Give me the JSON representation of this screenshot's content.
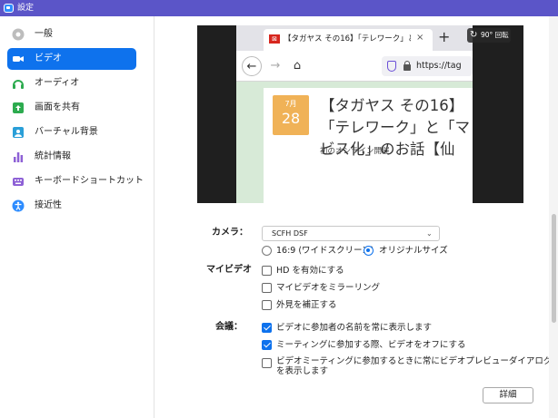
{
  "window": {
    "title": "設定"
  },
  "sidebar": {
    "items": [
      {
        "label": "一般",
        "icon": "gear-icon",
        "color": "#9e9e9e"
      },
      {
        "label": "ビデオ",
        "icon": "video-camera-icon",
        "color": "#ffffff",
        "active": true
      },
      {
        "label": "オーディオ",
        "icon": "headphones-icon",
        "color": "#2dab4f"
      },
      {
        "label": "画面を共有",
        "icon": "share-screen-icon",
        "color": "#2dab4f"
      },
      {
        "label": "バーチャル背景",
        "icon": "virtual-background-icon",
        "color": "#2a9fd8"
      },
      {
        "label": "統計情報",
        "icon": "statistics-icon",
        "color": "#8e61d6"
      },
      {
        "label": "キーボードショートカット",
        "icon": "keyboard-icon",
        "color": "#8e61d6"
      },
      {
        "label": "接近性",
        "icon": "accessibility-icon",
        "color": "#2d8cff"
      }
    ]
  },
  "preview": {
    "tab_title": "【タガヤス その16】「テレワーク」と「マ",
    "tab_close": "×",
    "new_tab": "+",
    "url": "https://tag",
    "date_month": "7月",
    "date_day": "28",
    "heading": "【タガヤス その16】「テレワーク」と「マ ビス化」のお話【仙",
    "subtitle": "初のオンライン開催",
    "rotate_label": "90° 回転"
  },
  "camera": {
    "label": "カメラ：",
    "selected": "SCFH DSF",
    "aspect_options": [
      {
        "label": "16:9 (ワイドスクリーン)",
        "selected": false
      },
      {
        "label": "オリジナルサイズ",
        "selected": true
      }
    ]
  },
  "my_video": {
    "label": "マイビデオ",
    "options": [
      {
        "label": "HD を有効にする",
        "checked": false
      },
      {
        "label": "マイビデオをミラーリング",
        "checked": false
      },
      {
        "label": "外見を補正する",
        "checked": false
      }
    ]
  },
  "meeting": {
    "label": "会議：",
    "options": [
      {
        "label": "ビデオに参加者の名前を常に表示します",
        "checked": true
      },
      {
        "label": "ミーティングに参加する際、ビデオをオフにする",
        "checked": true
      },
      {
        "label": "ビデオミーティングに参加するときに常にビデオプレビューダイアログを表示します",
        "checked": false
      }
    ]
  },
  "advanced_button": "詳細",
  "colors": {
    "accent": "#0e72ed",
    "titlebar": "#5b55c8"
  }
}
